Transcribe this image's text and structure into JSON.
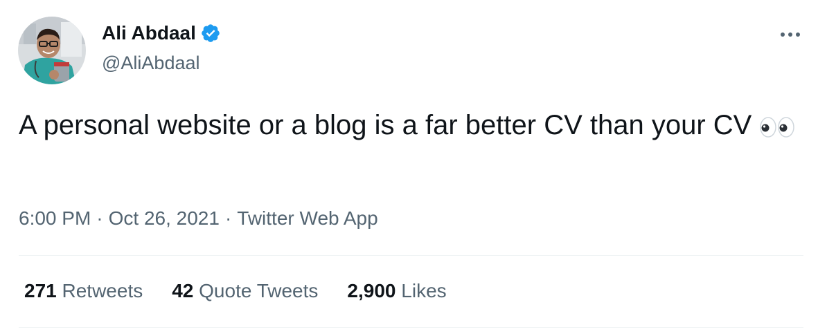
{
  "author": {
    "display_name": "Ali Abdaal",
    "handle": "@AliAbdaal",
    "verified": true,
    "verified_icon": "verified-badge-icon",
    "avatar_icon": "profile-photo"
  },
  "more_icon": "more-horizontal-icon",
  "tweet": {
    "text": "A personal website or a blog is a far better CV than your CV",
    "emoji_icon": "eyes-emoji-icon"
  },
  "meta": {
    "time": "6:00 PM",
    "separator": "·",
    "date": "Oct 26, 2021",
    "source": "Twitter Web App"
  },
  "stats": [
    {
      "count": "271",
      "label": "Retweets"
    },
    {
      "count": "42",
      "label": "Quote Tweets"
    },
    {
      "count": "2,900",
      "label": "Likes"
    }
  ],
  "colors": {
    "text_primary": "#0f1419",
    "text_secondary": "#536471",
    "verified_blue": "#1d9bf0",
    "divider": "#eff3f4"
  }
}
